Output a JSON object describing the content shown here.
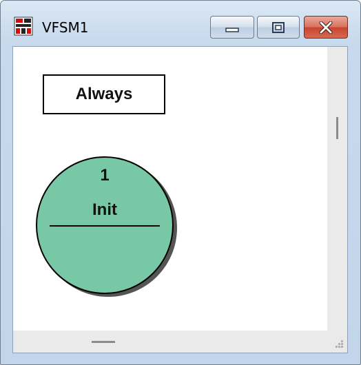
{
  "window": {
    "title": "VFSM1"
  },
  "canvas": {
    "transition_label": "Always",
    "state": {
      "id": "1",
      "name": "Init",
      "fill_color": "#78c8a6"
    }
  },
  "colors": {
    "close_button": "#c7432c",
    "titlebar": "#c7d9ec"
  },
  "icons": {
    "app": "vfsm-app-icon",
    "minimize": "minimize-icon",
    "maximize": "maximize-icon",
    "close": "close-icon"
  }
}
